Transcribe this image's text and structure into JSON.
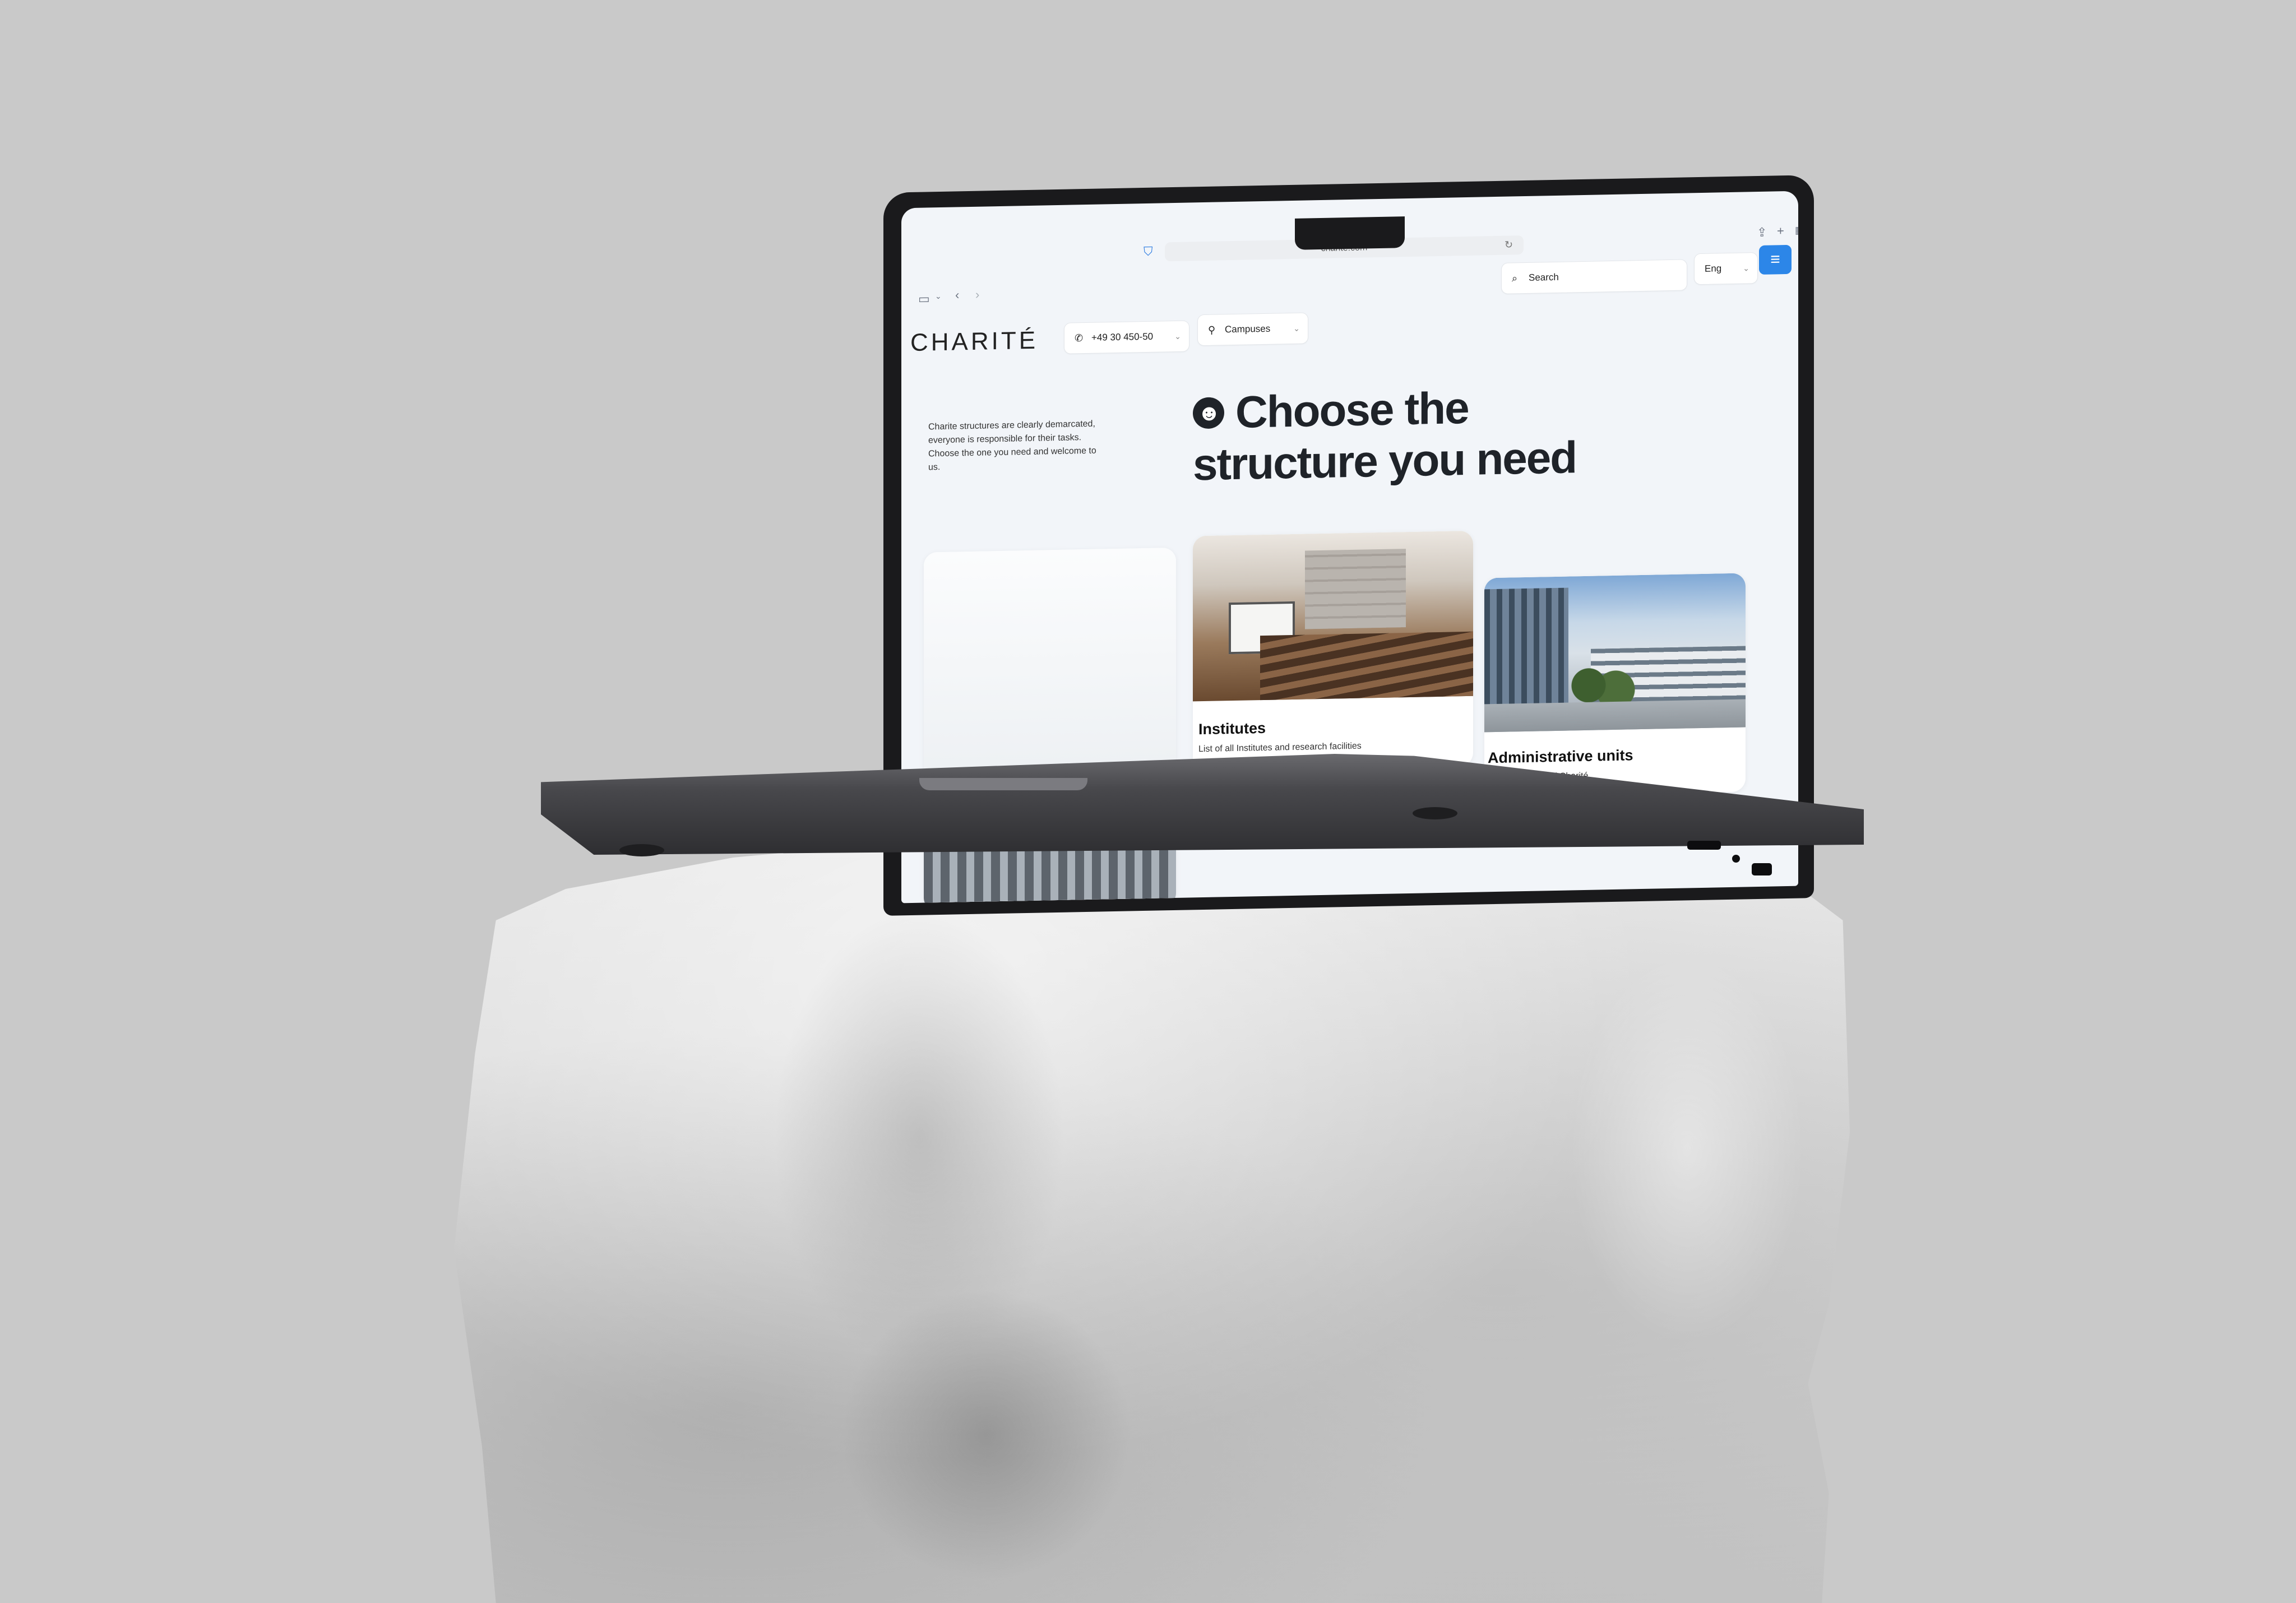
{
  "browser": {
    "url": "charite.com"
  },
  "site": {
    "logo": "CHARITÉ",
    "phone": "+49 30 450-50",
    "campuses_label": "Campuses",
    "search_placeholder": "Search",
    "language": "Eng"
  },
  "hero": {
    "intro": "Charite structures are clearly demarcated, everyone is responsible for their tasks. Choose the one you need and welcome to us.",
    "headline_line1": "Choose the",
    "headline_line2": "structure you need"
  },
  "cards": [
    {
      "title": "",
      "description": ""
    },
    {
      "title": "Institutes",
      "description": "List of all Institutes and research facilities"
    },
    {
      "title": "Administrative units",
      "description": "e structure of Charité"
    }
  ],
  "colors": {
    "accent": "#2c86e8",
    "background": "#c9c9c9",
    "page": "#f2f5f9",
    "text_dark": "#1f2329"
  },
  "icons": [
    "sidebar-icon",
    "back-icon",
    "forward-icon",
    "shield-icon",
    "reload-icon",
    "share-icon",
    "plus-icon",
    "tabs-icon",
    "phone-icon",
    "pin-icon",
    "search-icon",
    "menu-icon",
    "smile-icon"
  ]
}
